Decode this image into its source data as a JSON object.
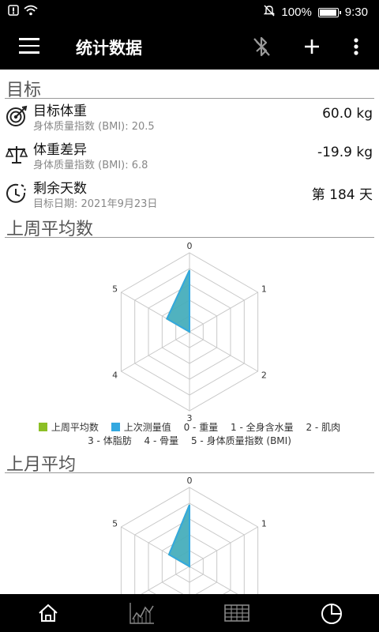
{
  "status": {
    "percent": "100%",
    "time": "9:30"
  },
  "appbar": {
    "title": "统计数据"
  },
  "goals": {
    "section_title": "目标",
    "weight": {
      "title": "目标体重",
      "subtitle": "身体质量指数 (BMI): 20.5",
      "value": "60.0 kg"
    },
    "diff": {
      "title": "体重差异",
      "subtitle": "身体质量指数 (BMI): 6.8",
      "value": "-19.9 kg"
    },
    "days": {
      "title": "剩余天数",
      "subtitle": "目标日期:  2021年9月23日",
      "value": "第 184 天"
    }
  },
  "weekly": {
    "section_title": "上周平均数"
  },
  "monthly": {
    "section_title": "上月平均"
  },
  "legend": {
    "series1": "上周平均数",
    "series2": "上次测量值",
    "axis0": "0 - 重量",
    "axis1": "1 - 全身含水量",
    "axis2": "2 - 肌肉",
    "axis3": "3 - 体脂肪",
    "axis4": "4 - 骨量",
    "axis5": "5 - 身体质量指数 (BMI)"
  },
  "colors": {
    "series1": "#8cbf26",
    "series2": "#33a8e0",
    "grid": "#c8c8c8"
  },
  "chart_data": [
    {
      "type": "radar",
      "axes": [
        "0",
        "1",
        "2",
        "3",
        "4",
        "5"
      ],
      "series": [
        {
          "name": "上周平均数",
          "values": [
            0.78,
            0.0,
            0.0,
            0.0,
            0.0,
            0.33
          ]
        },
        {
          "name": "上次测量值",
          "values": [
            0.78,
            0.0,
            0.0,
            0.0,
            0.0,
            0.33
          ]
        }
      ],
      "range": [
        0,
        1
      ],
      "rings": 5
    },
    {
      "type": "radar",
      "axes": [
        "0",
        "1",
        "2",
        "3",
        "4",
        "5"
      ],
      "series": [
        {
          "name": "上周平均数",
          "values": [
            0.78,
            0.0,
            0.0,
            0.0,
            0.0,
            0.3
          ]
        },
        {
          "name": "上次测量值",
          "values": [
            0.78,
            0.0,
            0.0,
            0.0,
            0.0,
            0.3
          ]
        }
      ],
      "range": [
        0,
        1
      ],
      "rings": 5
    }
  ]
}
